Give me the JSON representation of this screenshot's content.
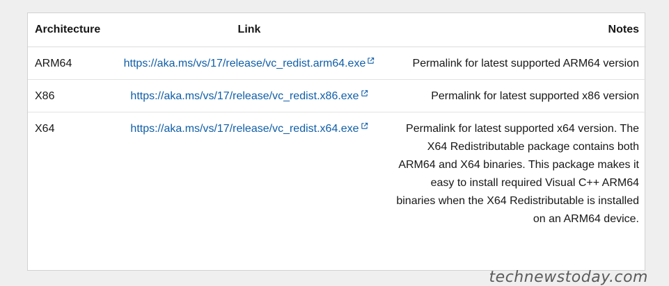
{
  "table": {
    "headers": {
      "architecture": "Architecture",
      "link": "Link",
      "notes": "Notes"
    },
    "rows": [
      {
        "architecture": "ARM64",
        "link": "https://aka.ms/vs/17/release/vc_redist.arm64.exe",
        "notes": "Permalink for latest supported ARM64 version"
      },
      {
        "architecture": "X86",
        "link": "https://aka.ms/vs/17/release/vc_redist.x86.exe",
        "notes": "Permalink for latest supported x86 version"
      },
      {
        "architecture": "X64",
        "link": "https://aka.ms/vs/17/release/vc_redist.x64.exe",
        "notes": "Permalink for latest supported x64 version. The X64 Redistributable package contains both ARM64 and X64 binaries. This package makes it easy to install required Visual C++ ARM64 binaries when the X64 Redistributable is installed on an ARM64 device."
      }
    ]
  },
  "watermark": "technewstoday.com",
  "colors": {
    "link": "#0f5ea8",
    "background": "#efefef"
  },
  "icons": {
    "external_link": "external-link-icon"
  }
}
